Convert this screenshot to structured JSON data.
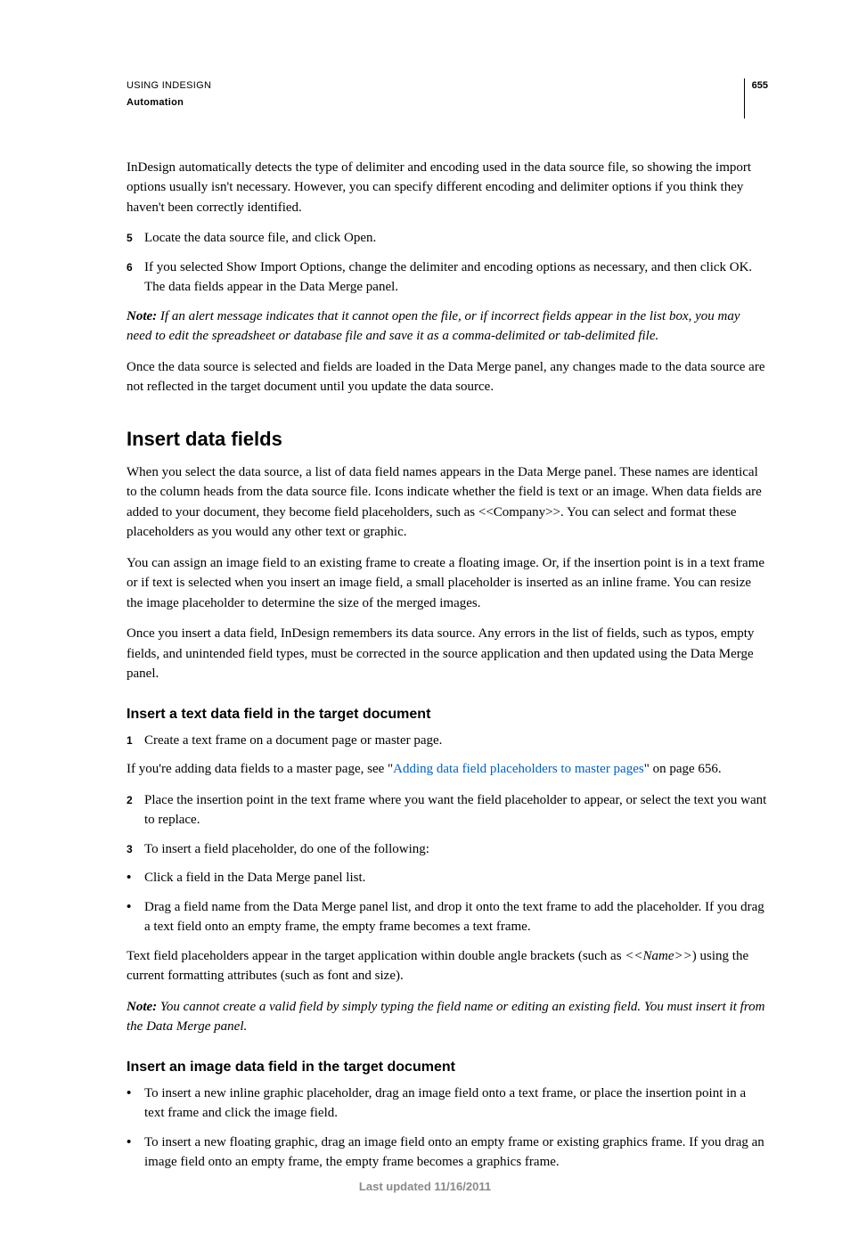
{
  "header": {
    "title": "USING INDESIGN",
    "section": "Automation",
    "page_number": "655"
  },
  "intro_paragraph": "InDesign automatically detects the type of delimiter and encoding used in the data source file, so showing the import options usually isn't necessary. However, you can specify different encoding and delimiter options if you think they haven't been correctly identified.",
  "steps_a": [
    {
      "num": "5",
      "text": "Locate the data source file, and click Open."
    },
    {
      "num": "6",
      "text": "If you selected Show Import Options, change the delimiter and encoding options as necessary, and then click OK. The data fields appear in the Data Merge panel."
    }
  ],
  "note1_label": "Note:",
  "note1_text": " If an alert message indicates that it cannot open the file, or if incorrect fields appear in the list box, you may need to edit the spreadsheet or database file and save it as a comma-delimited or tab-delimited file.",
  "para_after_note1": "Once the data source is selected and fields are loaded in the Data Merge panel, any changes made to the data source are not reflected in the target document until you update the data source.",
  "h2_insert": "Insert data fields",
  "insert_paras": [
    "When you select the data source, a list of data field names appears in the Data Merge panel. These names are identical to the column heads from the data source file. Icons indicate whether the field is text or an image. When data fields are added to your document, they become field placeholders, such as <<Company>>. You can select and format these placeholders as you would any other text or graphic.",
    "You can assign an image field to an existing frame to create a floating image. Or, if the insertion point is in a text frame or if text is selected when you insert an image field, a small placeholder is inserted as an inline frame. You can resize the image placeholder to determine the size of the merged images.",
    "Once you insert a data field, InDesign remembers its data source. Any errors in the list of fields, such as typos, empty fields, and unintended field types, must be corrected in the source application and then updated using the Data Merge panel."
  ],
  "h3_text": "Insert a text data field in the target document",
  "text_step1": {
    "num": "1",
    "text": "Create a text frame on a document page or master page."
  },
  "master_prefix": "If you're adding data fields to a master page, see \"",
  "master_link": "Adding data field placeholders to master pages",
  "master_suffix": "\" on page 656.",
  "text_steps_23": [
    {
      "num": "2",
      "text": "Place the insertion point in the text frame where you want the field placeholder to appear, or select the text you want to replace."
    },
    {
      "num": "3",
      "text": "To insert a field placeholder, do one of the following:"
    }
  ],
  "text_bullets": [
    "Click a field in the Data Merge panel list.",
    "Drag a field name from the Data Merge panel list, and drop it onto the text frame to add the placeholder. If you drag a text field onto an empty frame, the empty frame becomes a text frame."
  ],
  "text_after_prefix": "Text field placeholders appear in the target application within double angle brackets (such as ",
  "text_after_name": "<<Name>>",
  "text_after_suffix": ") using the current formatting attributes (such as font and size).",
  "note2_label": "Note:",
  "note2_text": " You cannot create a valid field by simply typing the field name or editing an existing field. You must insert it from the Data Merge panel.",
  "h3_image": "Insert an image data field in the target document",
  "image_bullets": [
    "To insert a new inline graphic placeholder, drag an image field onto a text frame, or place the insertion point in a text frame and click the image field.",
    "To insert a new floating graphic, drag an image field onto an empty frame or existing graphics frame. If you drag an image field onto an empty frame, the empty frame becomes a graphics frame."
  ],
  "footer": "Last updated 11/16/2011"
}
